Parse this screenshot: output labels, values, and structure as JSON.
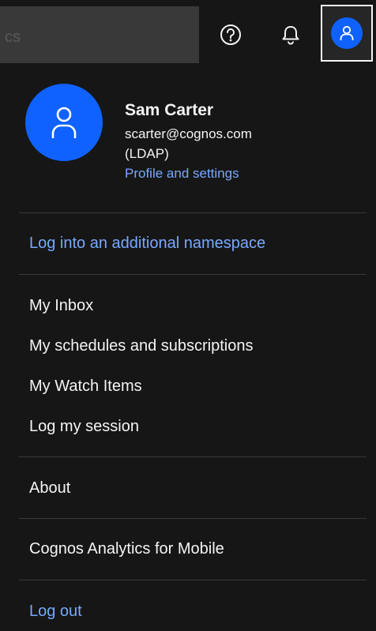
{
  "topbar": {
    "search_fragment": "cs",
    "icons": {
      "help": "help-icon",
      "notifications": "bell-icon",
      "profile": "user-icon"
    }
  },
  "user": {
    "name": "Sam Carter",
    "email": "scarter@cognos.com",
    "namespace": "(LDAP)",
    "profile_link": "Profile and settings"
  },
  "menu": {
    "additional_namespace": "Log into an additional namespace",
    "inbox": "My Inbox",
    "schedules": "My schedules and subscriptions",
    "watch_items": "My Watch Items",
    "log_session": "Log my session",
    "about": "About",
    "mobile": "Cognos Analytics for Mobile",
    "logout": "Log out"
  },
  "colors": {
    "background": "#161616",
    "accent": "#0f62fe",
    "link": "#78a9ff",
    "text": "#f4f4f4",
    "divider": "#393939"
  }
}
